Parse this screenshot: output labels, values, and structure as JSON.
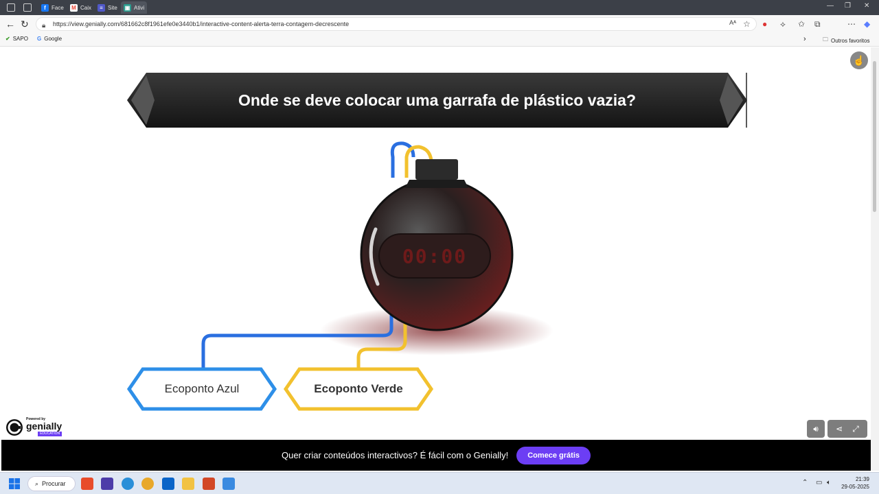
{
  "browser": {
    "tabs": [
      {
        "label": "Face",
        "color": "#1877f2",
        "glyph": "f"
      },
      {
        "label": "Caix",
        "color": "#ea4335",
        "glyph": "M"
      },
      {
        "label": "Site",
        "color": "#5058c8",
        "glyph": "≡"
      },
      {
        "label": "Ativi",
        "color": "#2a9d8f",
        "glyph": "▣"
      }
    ],
    "url": "https://view.genially.com/681662c8f1961efe0e3440b1/interactive-content-alerta-terra-contagem-decrescente",
    "bookmarks": [
      {
        "label": "SAPO"
      },
      {
        "label": "Google"
      }
    ],
    "other_favorites": "Outros favoritos",
    "icons": [
      "back-icon",
      "refresh-icon",
      "lock-icon",
      "read-aloud-icon",
      "star-icon",
      "extension-icon",
      "favorites-icon",
      "collections-icon",
      "more-icon",
      "copilot-icon"
    ]
  },
  "game": {
    "question": "Onde se deve colocar uma garrafa de plástico vazia?",
    "timer": "00:00",
    "answers": [
      {
        "label": "Ecoponto Azul",
        "color": "#2e8fe8"
      },
      {
        "label": "Ecoponto Verde",
        "color": "#f2c12e"
      }
    ],
    "logo": {
      "powered": "Powered by",
      "name": "genially",
      "badge": "EDUCATION"
    }
  },
  "promo": {
    "text": "Quer criar conteúdos interactivos? É fácil com o Genially!",
    "button": "Comece grátis",
    "accent": "#6c3ef4"
  },
  "taskbar": {
    "search": "Procurar",
    "time": "21:39",
    "date": "29-05-2025"
  }
}
